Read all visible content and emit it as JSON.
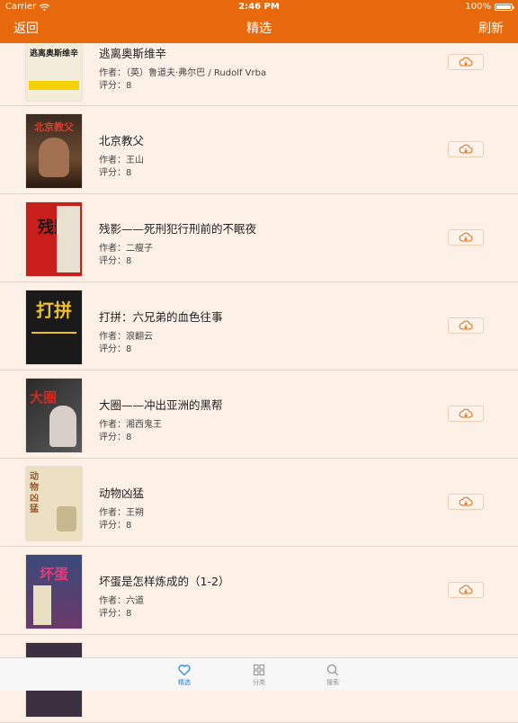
{
  "status_bar": {
    "carrier": "Carrier",
    "time": "2:46 PM",
    "battery": "100%",
    "battery_level": 1.0
  },
  "nav": {
    "back_label": "返回",
    "title": "精选",
    "refresh_label": "刷新"
  },
  "books": [
    {
      "title": "逃离奥斯维辛",
      "author": "作者：（英）鲁道夫·弗尔巴 / Rudolf Vrba",
      "score": "评分：8",
      "cover_text": "逃离奥斯维辛",
      "cover_bg": "#f2ecd8",
      "cover_fg": "#222222"
    },
    {
      "title": "北京教父",
      "author": "作者：王山",
      "score": "评分：8",
      "cover_text": "北京教父",
      "cover_bg": "#3a2a20",
      "cover_fg": "#e23a2a"
    },
    {
      "title": "残影——死刑犯行刑前的不眠夜",
      "author": "作者：二瘦子",
      "score": "评分：8",
      "cover_text": "残影",
      "cover_bg": "#c91f1c",
      "cover_fg": "#ffffff"
    },
    {
      "title": "打拼：六兄弟的血色往事",
      "author": "作者：浪翻云",
      "score": "评分：8",
      "cover_text": "打拼",
      "cover_bg": "#1a1a1a",
      "cover_fg": "#f0c020"
    },
    {
      "title": "大圈——冲出亚洲的黑帮",
      "author": "作者：湘西鬼王",
      "score": "评分：8",
      "cover_text": "大圈",
      "cover_bg": "#2a2a2a",
      "cover_fg": "#d8261c"
    },
    {
      "title": "动物凶猛",
      "author": "作者：王朔",
      "score": "评分：8",
      "cover_text": "动物凶猛",
      "cover_bg": "#ede0c2",
      "cover_fg": "#9a5a30"
    },
    {
      "title": "坏蛋是怎样炼成的（1-2）",
      "author": "作者：六道",
      "score": "评分：8",
      "cover_text": "坏蛋",
      "cover_bg": "#3a4a7a",
      "cover_fg": "#e63a7a"
    },
    {
      "title": "",
      "author": "",
      "score": "",
      "cover_text": "",
      "cover_bg": "#3a3040",
      "cover_fg": "#e0a030"
    }
  ],
  "tabs": [
    {
      "label": "精选",
      "icon": "heart-icon",
      "active": true
    },
    {
      "label": "分类",
      "icon": "grid-icon",
      "active": false
    },
    {
      "label": "搜索",
      "icon": "search-icon",
      "active": false
    }
  ],
  "colors": {
    "accent": "#e8690c",
    "background": "#fdf0e6",
    "tab_active": "#1a7cf5",
    "tab_inactive": "#8e8e93"
  }
}
